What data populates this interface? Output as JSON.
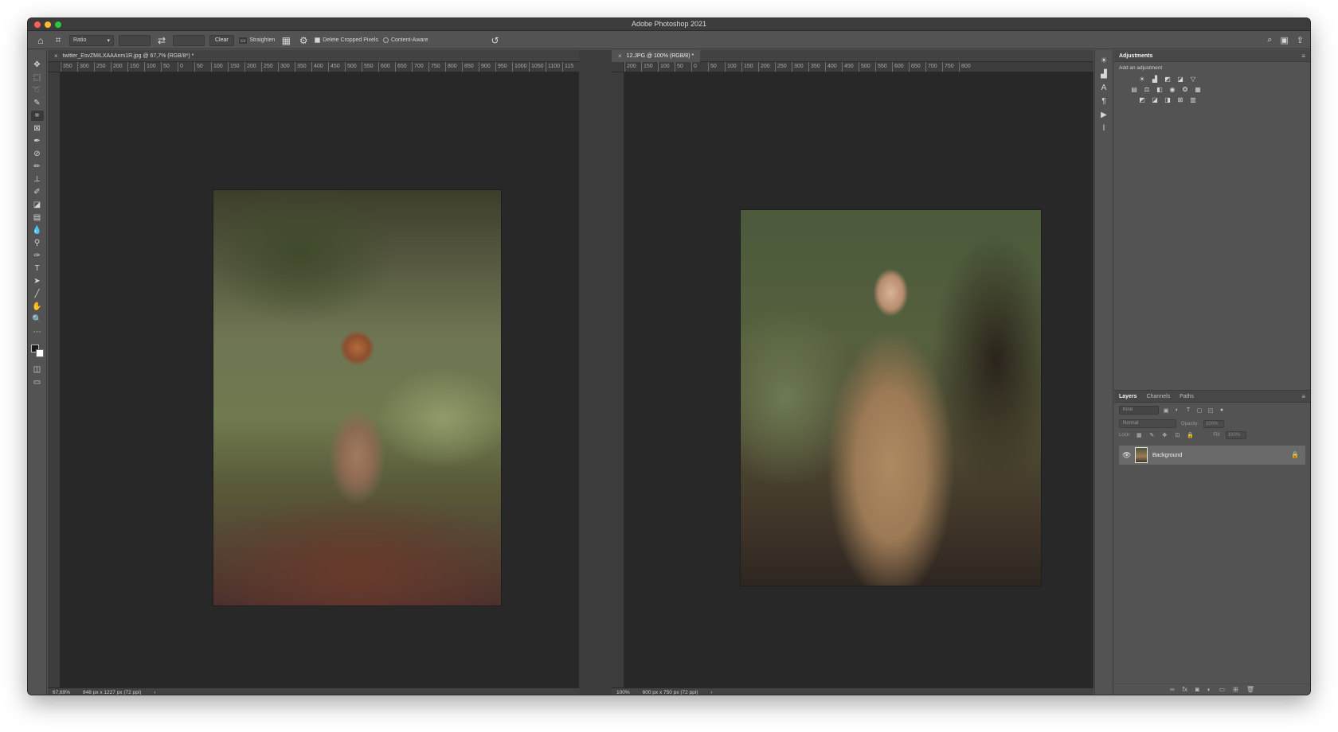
{
  "app": {
    "title": "Adobe Photoshop 2021"
  },
  "options_bar": {
    "ratio_select": "Ratio",
    "clear_label": "Clear",
    "straighten_label": "Straighten",
    "delete_cropped_label": "Delete Cropped Pixels",
    "delete_cropped_checked": true,
    "content_aware_label": "Content-Aware",
    "content_aware_checked": false
  },
  "documents": [
    {
      "tab_title": "twitter_EsvZMILXAAAnm1R.jpg @ 67,7% (RGB/8*) *",
      "ruler_ticks": [
        "350",
        "300",
        "250",
        "200",
        "150",
        "100",
        "50",
        "0",
        "50",
        "100",
        "150",
        "200",
        "250",
        "300",
        "350",
        "400",
        "450",
        "500",
        "550",
        "600",
        "650",
        "700",
        "750",
        "800",
        "850",
        "900",
        "950",
        "1000",
        "1050",
        "1100",
        "115"
      ],
      "zoom": "67,69%",
      "dimensions": "848 px x 1227 px (72 ppi)"
    },
    {
      "tab_title": "12.JPG @ 100% (RGB/8) *",
      "ruler_ticks": [
        "200",
        "150",
        "100",
        "50",
        "0",
        "50",
        "100",
        "150",
        "200",
        "250",
        "300",
        "350",
        "400",
        "450",
        "500",
        "550",
        "600",
        "650",
        "700",
        "750",
        "800"
      ],
      "zoom": "100%",
      "dimensions": "600 px x 750 px (72 ppi)"
    }
  ],
  "adjustments": {
    "title": "Adjustments",
    "subtitle": "Add an adjustment"
  },
  "layers": {
    "tabs": [
      "Layers",
      "Channels",
      "Paths"
    ],
    "filter_placeholder": "Kind",
    "blend_mode": "Normal",
    "opacity_label": "Opacity:",
    "opacity_value": "100%",
    "lock_label": "Lock:",
    "fill_label": "Fill:",
    "fill_value": "100%",
    "items": [
      {
        "name": "Background",
        "visible": true,
        "locked": true
      }
    ]
  }
}
